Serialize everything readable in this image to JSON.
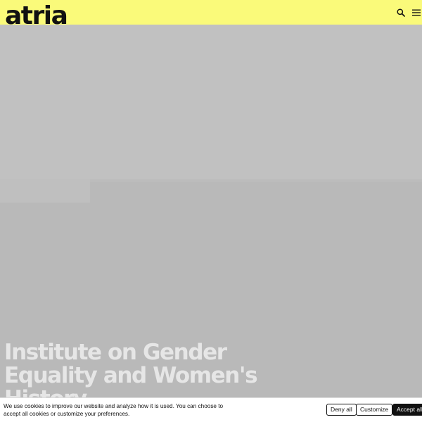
{
  "header": {
    "logo_text": "atria",
    "search_icon": "search-icon",
    "menu_icon": "hamburger-menu-icon",
    "background_color": "#fafa7a"
  },
  "hero": {
    "title": "Institute on Gender\nEquality and Women's\nHistory"
  },
  "cookie_banner": {
    "text": "We use cookies to improve our website and analyze how it is used. You can choose to accept all cookies or customize your preferences.",
    "deny_label": "Deny all",
    "customize_label": "Customize",
    "accept_label": "Accept all"
  }
}
